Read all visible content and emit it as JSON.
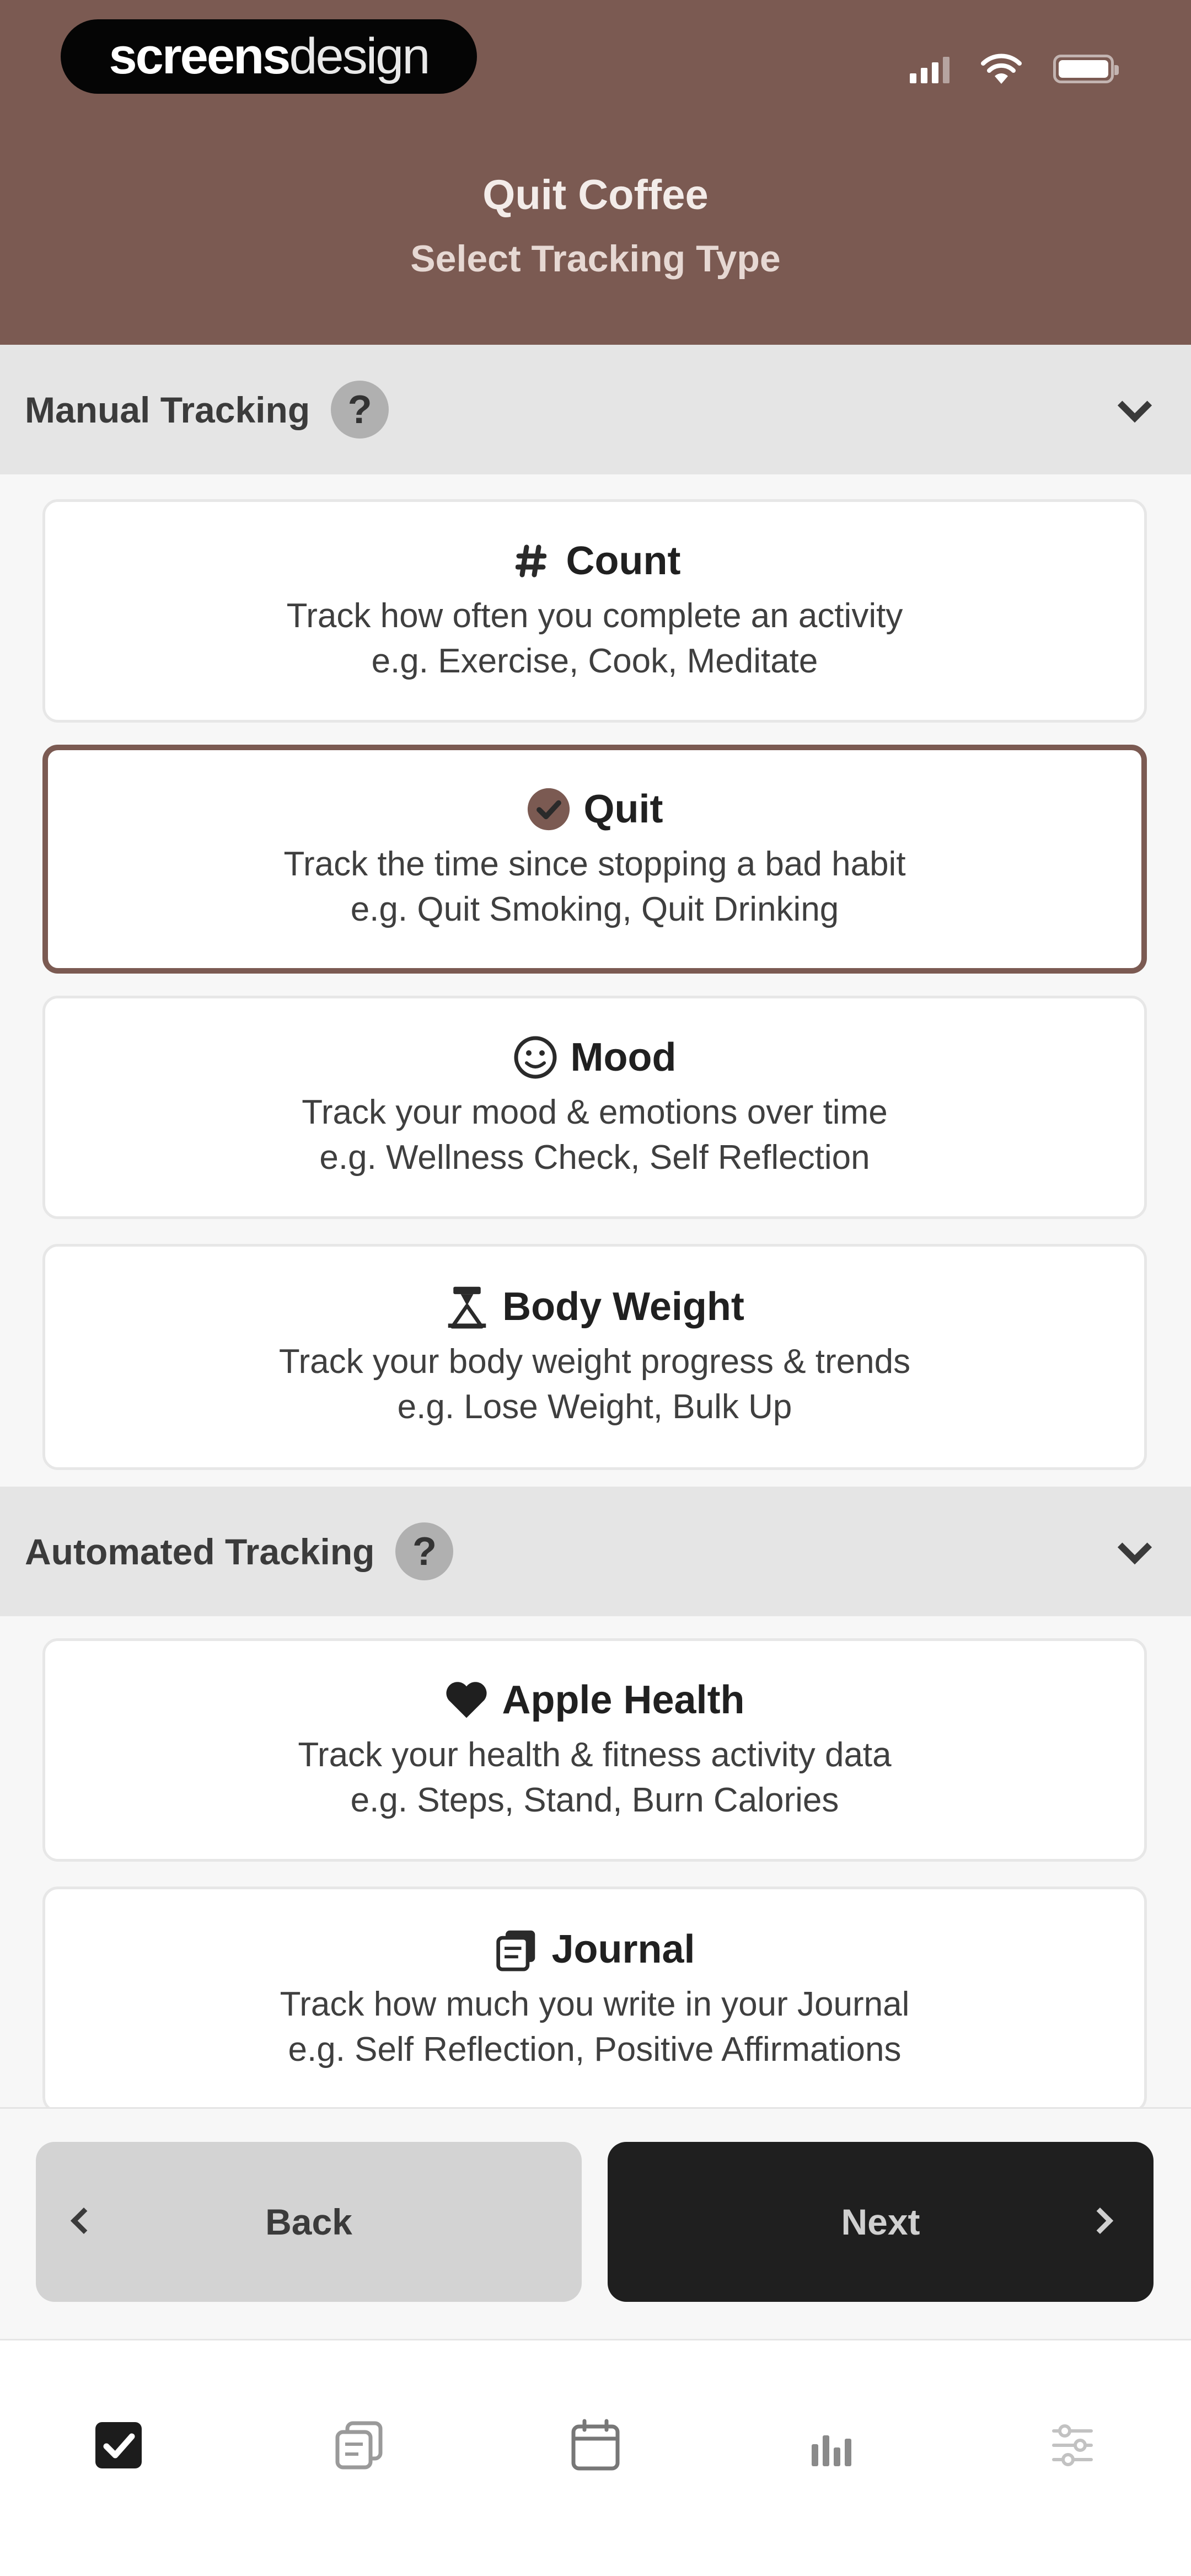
{
  "brand": {
    "strong": "screens",
    "light": "design"
  },
  "header": {
    "title": "Quit Coffee",
    "subtitle": "Select Tracking Type"
  },
  "sections": {
    "manual": {
      "title": "Manual Tracking",
      "help": "?"
    },
    "automated": {
      "title": "Automated Tracking",
      "help": "?"
    }
  },
  "cards": {
    "count": {
      "title": "Count",
      "line1": "Track how often you complete an activity",
      "line2": "e.g. Exercise, Cook, Meditate",
      "icon": "hash-icon"
    },
    "quit": {
      "title": "Quit",
      "line1": "Track the time since stopping a bad habit",
      "line2": "e.g. Quit Smoking, Quit Drinking",
      "icon": "checkmark-circle-icon",
      "selected": true
    },
    "mood": {
      "title": "Mood",
      "line1": "Track your mood & emotions over time",
      "line2": "e.g. Wellness Check, Self Reflection",
      "icon": "smiley-icon"
    },
    "body_weight": {
      "title": "Body Weight",
      "line1": "Track your body weight progress & trends",
      "line2": "e.g. Lose Weight, Bulk Up",
      "icon": "scale-icon"
    },
    "apple_health": {
      "title": "Apple Health",
      "line1": "Track your health & fitness activity data",
      "line2": "e.g. Steps, Stand, Burn Calories",
      "icon": "heart-icon"
    },
    "journal": {
      "title": "Journal",
      "line1": "Track how much you write in your Journal",
      "line2": "e.g. Self Reflection, Positive Affirmations",
      "icon": "journal-icon"
    }
  },
  "footer": {
    "back_label": "Back",
    "next_label": "Next"
  },
  "tabbar": [
    "checkbox-icon",
    "journal-icon",
    "calendar-icon",
    "stats-icon",
    "settings-icon"
  ],
  "colors": {
    "accent": "#7b5a52",
    "dark": "#1f1f1f",
    "section_bg": "#e5e5e5"
  }
}
